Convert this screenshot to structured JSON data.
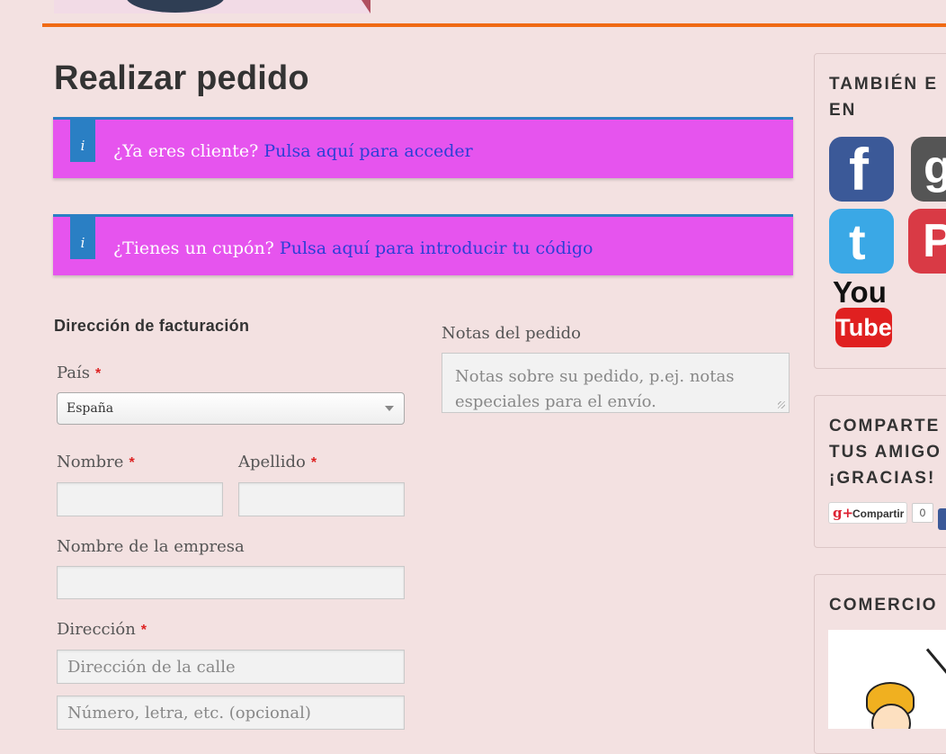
{
  "page": {
    "title": "Realizar pedido"
  },
  "notices": {
    "login": {
      "badge": "i",
      "text": "¿Ya eres cliente?",
      "link": "Pulsa aquí para acceder"
    },
    "coupon": {
      "badge": "i",
      "text": "¿Tienes un cupón?",
      "link": "Pulsa aquí para introducir tu código"
    }
  },
  "billing": {
    "heading": "Dirección de facturación",
    "required_mark": "*",
    "country_label": "País",
    "country_value": "España",
    "first_name_label": "Nombre",
    "last_name_label": "Apellido",
    "company_label": "Nombre de la empresa",
    "address_label": "Dirección",
    "address_1_placeholder": "Dirección de la calle",
    "address_2_placeholder": "Número, letra, etc. (opcional)"
  },
  "order_notes": {
    "label": "Notas del pedido",
    "placeholder": "Notas sobre su pedido, p.ej. notas especiales para el envío."
  },
  "sidebar": {
    "follow_title_line1": "TAMBIÉN E",
    "follow_title_line2": "EN",
    "social": {
      "facebook_glyph": "f",
      "google_glyph": "g",
      "twitter_glyph": "t",
      "pinterest_glyph": "P",
      "youtube_you": "You",
      "youtube_tube": "Tube"
    },
    "share_title_line1": "COMPARTE",
    "share_title_line2": "TUS AMIGO",
    "share_title_line3": "¡GRACIAS!",
    "gplus_icon": "g+",
    "gplus_label": "Compartir",
    "gplus_count": "0",
    "shop_title": "COMERCIO"
  },
  "colors": {
    "page_bg": "#f3e1e1",
    "accent_orange": "#f06a14",
    "notice_bg": "#e654ee",
    "notice_border": "#2a7fc4",
    "link": "#2c3fd6"
  }
}
